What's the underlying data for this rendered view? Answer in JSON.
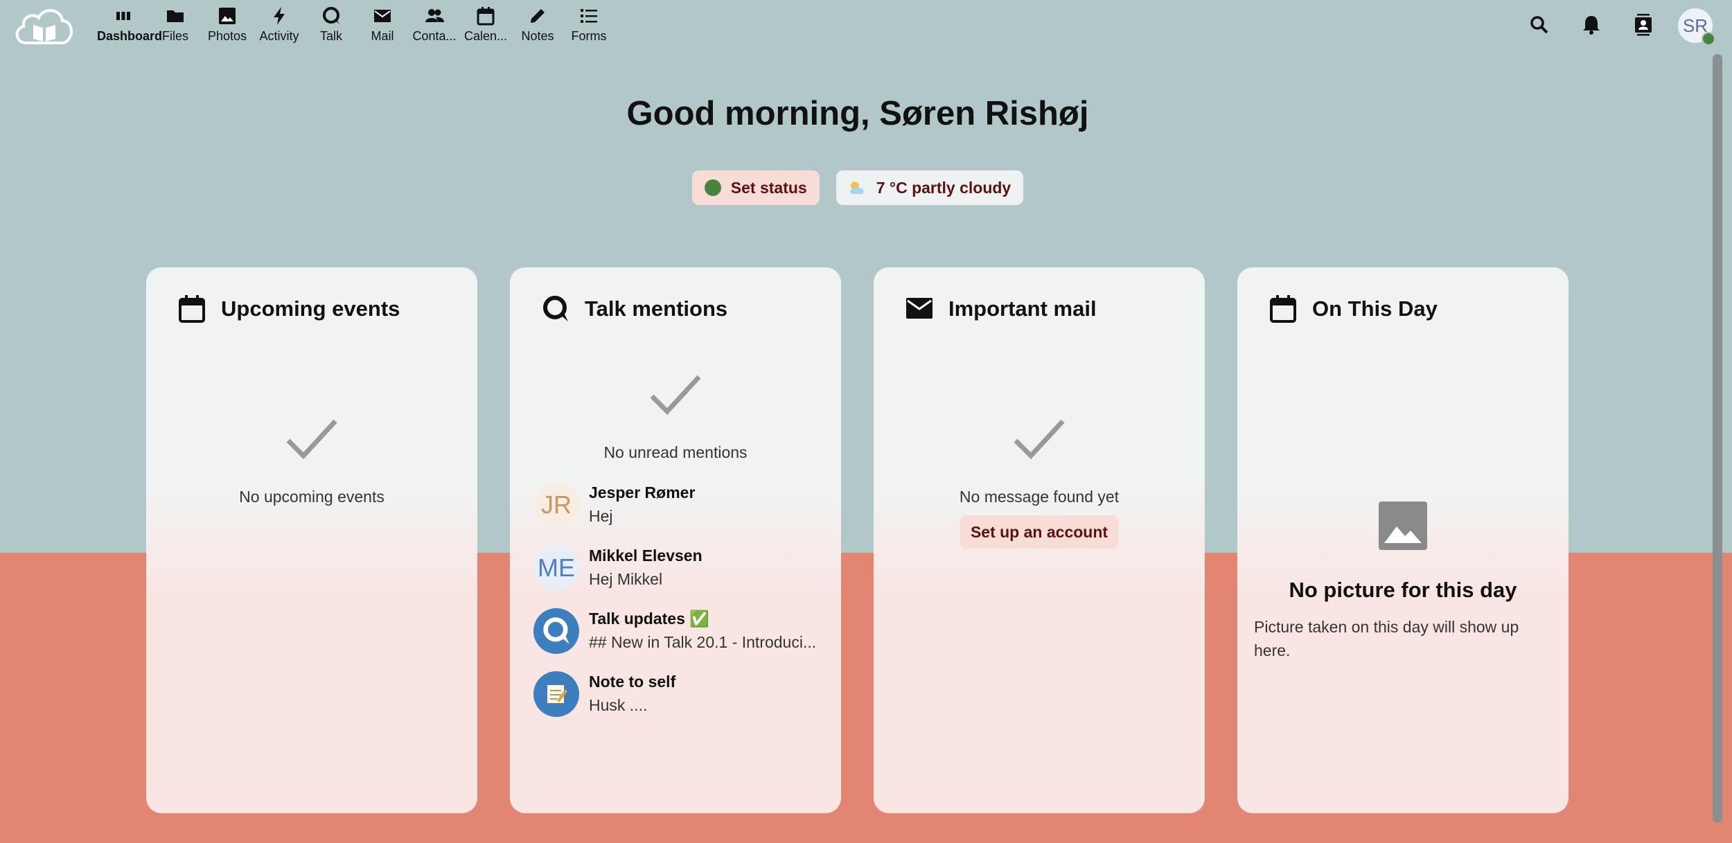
{
  "header": {
    "apps": [
      {
        "label": "Dashboard",
        "icon": "dashboard-icon",
        "active": true
      },
      {
        "label": "Files",
        "icon": "folder-icon"
      },
      {
        "label": "Photos",
        "icon": "image-icon"
      },
      {
        "label": "Activity",
        "icon": "lightning-icon"
      },
      {
        "label": "Talk",
        "icon": "talk-icon"
      },
      {
        "label": "Mail",
        "icon": "mail-icon"
      },
      {
        "label": "Conta...",
        "icon": "contacts-icon"
      },
      {
        "label": "Calen...",
        "icon": "calendar-icon"
      },
      {
        "label": "Notes",
        "icon": "pencil-icon"
      },
      {
        "label": "Forms",
        "icon": "list-icon"
      }
    ],
    "right_icons": [
      "search-icon",
      "bell-icon",
      "contacts-book-icon"
    ],
    "avatar_initials": "SR"
  },
  "greeting": "Good morning, Søren Rishøj",
  "status": {
    "set_status_label": "Set status",
    "weather_label": "7 °C partly cloudy"
  },
  "colors": {
    "background_top": "#b2c8c8",
    "background_bottom": "#e28573",
    "accent_text": "#5c1212",
    "online_green": "#49843f",
    "talk_blue": "#3d7ebf"
  },
  "panels": {
    "upcoming_events": {
      "title": "Upcoming events",
      "empty_text": "No upcoming events"
    },
    "talk_mentions": {
      "title": "Talk mentions",
      "empty_text": "No unread mentions",
      "items": [
        {
          "avatar": "JR",
          "name": "Jesper Rømer",
          "message": "Hej"
        },
        {
          "avatar": "ME",
          "name": "Mikkel Elevsen",
          "message": "Hej Mikkel"
        },
        {
          "avatar": "talk-icon",
          "name": "Talk updates ✅",
          "message": "## New in Talk 20.1 - Introduci..."
        },
        {
          "avatar": "notepad-icon",
          "name": "Note to self",
          "message": "Husk ...."
        }
      ]
    },
    "important_mail": {
      "title": "Important mail",
      "empty_text": "No message found yet",
      "setup_label": "Set up an account"
    },
    "on_this_day": {
      "title": "On This Day",
      "empty_title": "No picture for this day",
      "empty_text": "Picture taken on this day will show up here."
    }
  }
}
